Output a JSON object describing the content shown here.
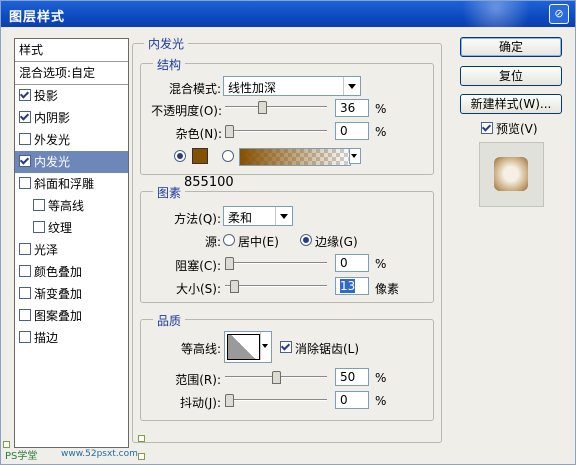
{
  "window": {
    "title": "图层样式",
    "help_icon": "help-icon"
  },
  "styles_list": {
    "header": "样式",
    "blend_options": "混合选项:自定",
    "items": [
      {
        "label": "投影",
        "checked": true,
        "indent": false,
        "selected": false
      },
      {
        "label": "内阴影",
        "checked": true,
        "indent": false,
        "selected": false
      },
      {
        "label": "外发光",
        "checked": false,
        "indent": false,
        "selected": false
      },
      {
        "label": "内发光",
        "checked": true,
        "indent": false,
        "selected": true
      },
      {
        "label": "斜面和浮雕",
        "checked": false,
        "indent": false,
        "selected": false
      },
      {
        "label": "等高线",
        "checked": false,
        "indent": true,
        "selected": false
      },
      {
        "label": "纹理",
        "checked": false,
        "indent": true,
        "selected": false
      },
      {
        "label": "光泽",
        "checked": false,
        "indent": false,
        "selected": false
      },
      {
        "label": "颜色叠加",
        "checked": false,
        "indent": false,
        "selected": false
      },
      {
        "label": "渐变叠加",
        "checked": false,
        "indent": false,
        "selected": false
      },
      {
        "label": "图案叠加",
        "checked": false,
        "indent": false,
        "selected": false
      },
      {
        "label": "描边",
        "checked": false,
        "indent": false,
        "selected": false
      }
    ]
  },
  "inner_glow": {
    "title": "内发光",
    "structure": {
      "title": "结构",
      "blend_mode_label": "混合模式:",
      "blend_mode_value": "线性加深",
      "opacity_label": "不透明度(O):",
      "opacity_value": "36",
      "opacity_level": 36,
      "opacity_unit": "%",
      "noise_label": "杂色(N):",
      "noise_value": "0",
      "noise_level": 0,
      "noise_unit": "%",
      "color_hex": "#855100",
      "color_annotation": "855100"
    },
    "elements": {
      "title": "图素",
      "technique_label": "方法(Q):",
      "technique_value": "柔和",
      "source_label": "源:",
      "source_center": "居中(E)",
      "source_edge": "边缘(G)",
      "choke_label": "阻塞(C):",
      "choke_value": "0",
      "choke_level": 0,
      "choke_unit": "%",
      "size_label": "大小(S):",
      "size_value": "13",
      "size_level": 5,
      "size_unit": "像素"
    },
    "quality": {
      "title": "品质",
      "contour_label": "等高线:",
      "anti_alias_label": "消除锯齿(L)",
      "range_label": "范围(R):",
      "range_value": "50",
      "range_level": 50,
      "range_unit": "%",
      "jitter_label": "抖动(J):",
      "jitter_value": "0",
      "jitter_level": 0,
      "jitter_unit": "%"
    }
  },
  "buttons": {
    "ok": "确定",
    "reset": "复位",
    "new_style": "新建样式(W)...",
    "preview_label": "预览(V)"
  },
  "watermark": {
    "site": "PS学堂",
    "url": "www.52psxt.com"
  }
}
